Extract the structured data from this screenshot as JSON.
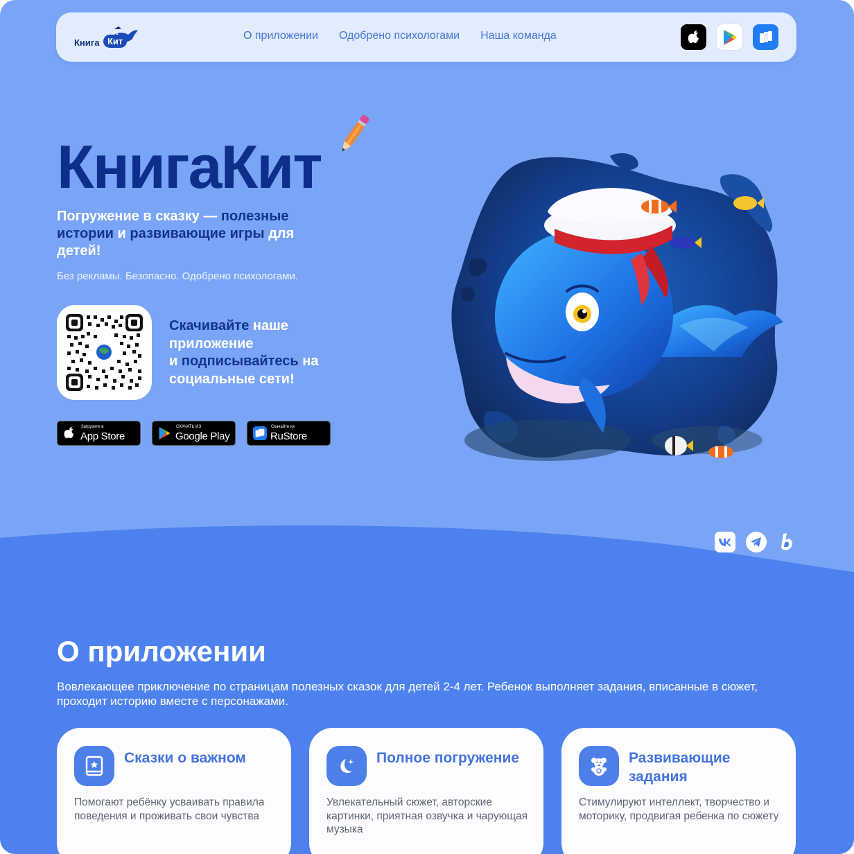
{
  "header": {
    "logo": {
      "word1": "Книга",
      "word2": "Кит"
    },
    "nav": [
      "О приложении",
      "Одобрено психологами",
      "Наша команда"
    ],
    "store_icons": [
      "apple-icon",
      "google-play-icon",
      "rustore-icon"
    ]
  },
  "hero": {
    "title": "КнигаКит",
    "tagline": {
      "p1": "Погружение в сказку — ",
      "p2": "полезные истории",
      "p3": " и ",
      "p4": "развивающие игры",
      "p5": " для детей!"
    },
    "subtagline": "Без рекламы. Безопасно. Одобрено психологами.",
    "cta": {
      "p1": "Скачивайте",
      "p2": " наше приложение",
      "p3": "и ",
      "p4": "подписывайтесь",
      "p5": " на социальные сети!"
    },
    "badges": [
      {
        "small": "Загрузите в",
        "big": "App Store"
      },
      {
        "small": "СКАЧАТЬ ИЗ",
        "big": "Google Play"
      },
      {
        "small": "Скачайте из",
        "big": "RuStore"
      }
    ],
    "illustration": "whale-in-sailor-hat-illustration"
  },
  "socials": [
    "vk-icon",
    "telegram-icon",
    "social-b-icon"
  ],
  "about": {
    "title": "О приложении",
    "description": "Вовлекающее приключение по страницам полезных сказок для детей 2-4 лет. Ребенок выполняет задания, вписанные в сюжет, проходит историю вместе с персонажами.",
    "cards": [
      {
        "icon": "book-star-icon",
        "title": "Сказки о важном",
        "text": "Помогают ребёнку усваивать правила поведения и проживать свои чувства"
      },
      {
        "icon": "moon-star-icon",
        "title": "Полное погружение",
        "text": "Увлекательный сюжет, авторские картинки, приятная озвучка и чарующая музыка"
      },
      {
        "icon": "teddy-bear-icon",
        "title": "Развивающие задания",
        "text": "Стимулируют интеллект, творчество и моторику, продвигая ребенка по сюжету"
      }
    ]
  },
  "colors": {
    "background": "#7aa5f6",
    "wave": "#4d82ee",
    "brand_dark": "#0c2f8c",
    "accent": "#4473de"
  }
}
